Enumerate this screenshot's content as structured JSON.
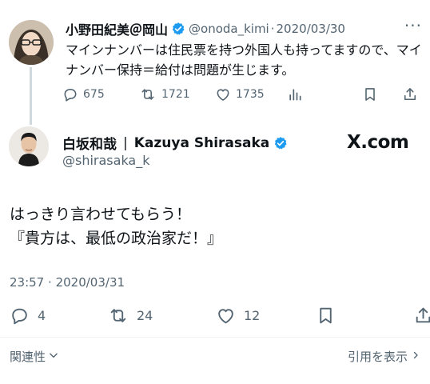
{
  "parent_tweet": {
    "display_name": "小野田紀美＠岡山",
    "handle": "@onoda_kimi",
    "separator": "·",
    "date": "2020/03/30",
    "more": "···",
    "text": "マインナンバーは住民票を持つ外国人も持ってますので、マイナンバー保持＝給付は問題が生じます。",
    "replies": "675",
    "reposts": "1721",
    "likes": "1735"
  },
  "main_tweet": {
    "display_name": "白坂和哉",
    "name_separator": "|",
    "display_name_en": "Kazuya Shirasaka",
    "handle": "@shirasaka_k",
    "text": "はっきり言わせてもらう！\n『貴方は、最低の政治家だ！』",
    "time": "23:57",
    "separator": "·",
    "date": "2020/03/31",
    "replies": "4",
    "reposts": "24",
    "likes": "12"
  },
  "brand_label": "X.com",
  "footer": {
    "related_label": "関連性",
    "quotes_label": "引用を表示"
  },
  "icons": [
    "reply-icon",
    "repost-icon",
    "like-icon",
    "views-icon",
    "bookmark-icon",
    "share-icon",
    "verified-badge-icon",
    "chevron-down-icon",
    "chevron-right-icon"
  ],
  "colors": {
    "verified_blue": "#1d9bf0",
    "secondary_text": "#536471",
    "primary_text": "#0f1419"
  }
}
